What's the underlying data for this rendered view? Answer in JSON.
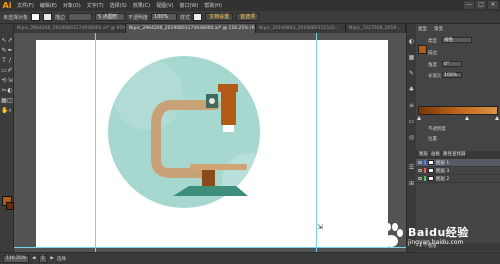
{
  "app": {
    "logo": "Ai"
  },
  "menu": [
    "文件(F)",
    "编辑(E)",
    "对象(O)",
    "文字(T)",
    "选择(S)",
    "效果(C)",
    "视图(V)",
    "窗口(W)",
    "帮助(H)"
  ],
  "window_controls": [
    "—",
    "□",
    "✕"
  ],
  "control_bar": {
    "selection_label": "未选择对象",
    "stroke_label": "描边",
    "stroke_weight": "",
    "brush": "5 点圆形",
    "style_label": "不透明度",
    "opacity": "100%",
    "style": "样式",
    "doc_setup": "文档设置",
    "preferences": "首选项"
  },
  "tabs": [
    {
      "label": "Nipic_2964206_20190803174938000.ai* @ 92% (RGB/...",
      "active": false
    },
    {
      "label": "Nipic_2964206_20190803174938000.ai* @ 116.25% (RGB/预览)",
      "active": true
    },
    {
      "label": "Nipic_20190803_2019080311542...",
      "active": false
    },
    {
      "label": "Nipic_7227928_2019...",
      "active": false
    }
  ],
  "tools": [
    "↖",
    "↗",
    "✎",
    "✒",
    "T",
    "/",
    "▭",
    "✐",
    "⟲",
    "⇲",
    "✂",
    "◐",
    "▦",
    "◫",
    "✋",
    "⌕"
  ],
  "panel": {
    "tabs": [
      "类型",
      "渐变"
    ],
    "type_label": "类型",
    "type_value": "线性",
    "stroke_label": "描边",
    "angle_label": "角度",
    "angle_value": "0°",
    "ratio_label": "长宽比",
    "ratio_value": "100%",
    "opacity_label": "不透明度",
    "location_label": "位置"
  },
  "layers": {
    "tabs": [
      "图层",
      "画板",
      "路径查找器"
    ],
    "items": [
      {
        "name": "图层 1",
        "color": "#4f7cff",
        "active": true
      },
      {
        "name": "图层 3",
        "color": "#ff4f4f",
        "active": false
      },
      {
        "name": "图层 2",
        "color": "#3fcf3f",
        "active": false
      }
    ],
    "footer": "3 个图层"
  },
  "status": {
    "zoom": "116.25%",
    "page": "1",
    "mode": "选择"
  },
  "watermark": {
    "text": "Baidu经验",
    "sub": "jingyan.baidu.com"
  },
  "colors": {
    "circle": "#a7d8d0",
    "tube": "#c8a276",
    "arm": "#c89b6a",
    "head": "#b35a16",
    "joint": "#3f6b5f",
    "base": "#3d8f7a",
    "stage": "#8a4a1a"
  }
}
